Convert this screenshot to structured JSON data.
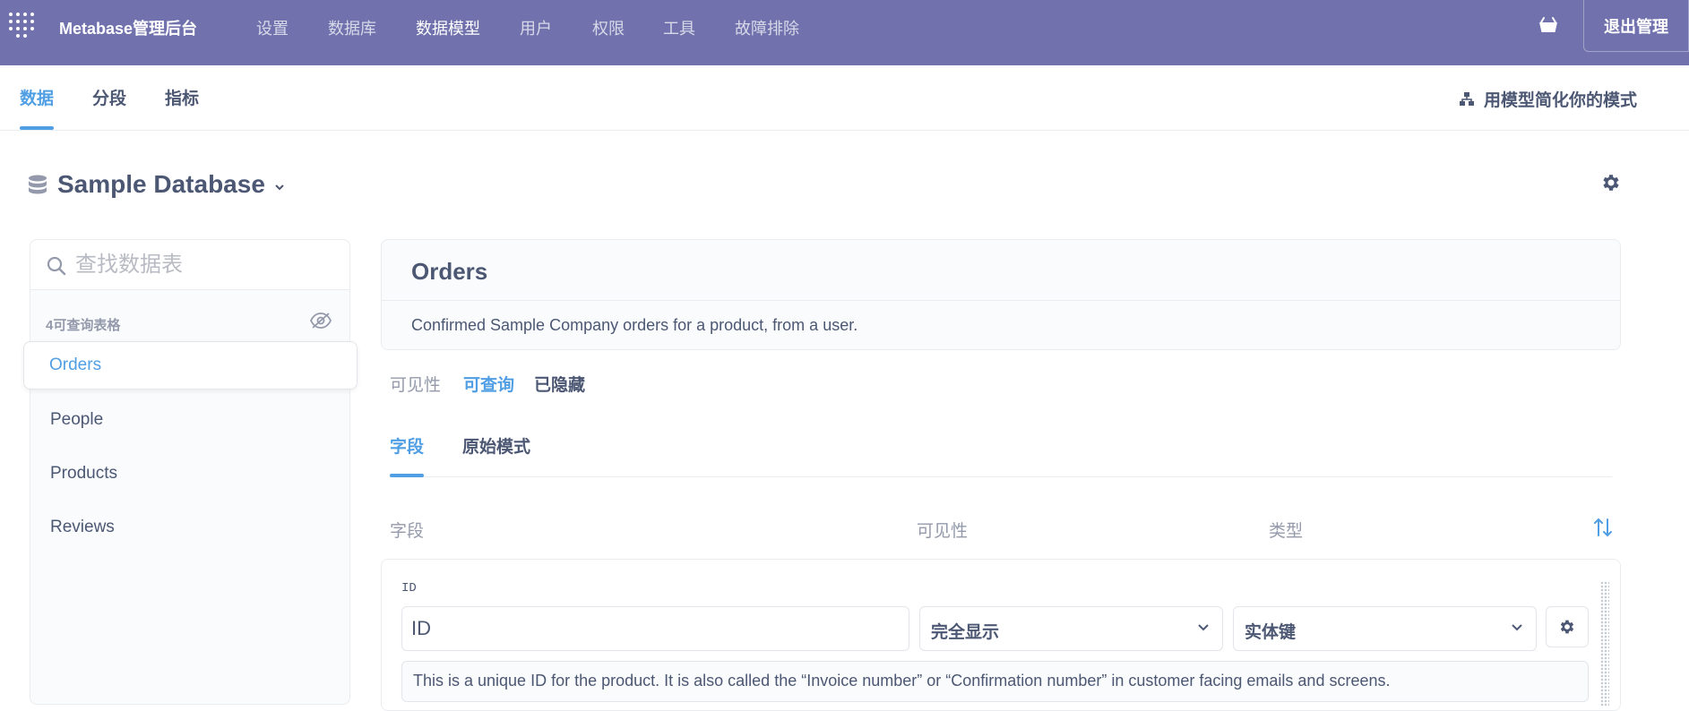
{
  "app": {
    "brand": "Metabase管理后台",
    "nav": [
      "设置",
      "数据库",
      "数据模型",
      "用户",
      "权限",
      "工具",
      "故障排除"
    ],
    "active_nav": "数据模型",
    "exit_label": "退出管理"
  },
  "subnav": {
    "tabs": [
      "数据",
      "分段",
      "指标"
    ],
    "active_tab": "数据",
    "simplify_label": "用模型简化你的模式"
  },
  "database": {
    "name": "Sample Database"
  },
  "sidebar": {
    "search_placeholder": "查找数据表",
    "count_label": "4可查询表格",
    "tables": [
      "Orders",
      "People",
      "Products",
      "Reviews"
    ],
    "active_table": "Orders"
  },
  "table": {
    "name": "Orders",
    "description": "Confirmed Sample Company orders for a product, from a user.",
    "visibility_label": "可见性",
    "visibility_queryable": "可查询",
    "visibility_hidden": "已隐藏",
    "tabs": [
      "字段",
      "原始模式"
    ],
    "active_tab": "字段",
    "columns": {
      "field": "字段",
      "visibility": "可见性",
      "type": "类型"
    }
  },
  "fields": [
    {
      "raw_name": "ID",
      "display_name": "ID",
      "visibility": "完全显示",
      "semantic_type": "实体键",
      "description": "This is a unique ID for the product. It is also called the “Invoice number” or “Confirmation number” in customer facing emails and screens."
    }
  ],
  "colors": {
    "nav_bg": "#7172ad",
    "brand_blue": "#509ee3",
    "text_dark": "#4c5773",
    "text_light": "#949aab"
  }
}
